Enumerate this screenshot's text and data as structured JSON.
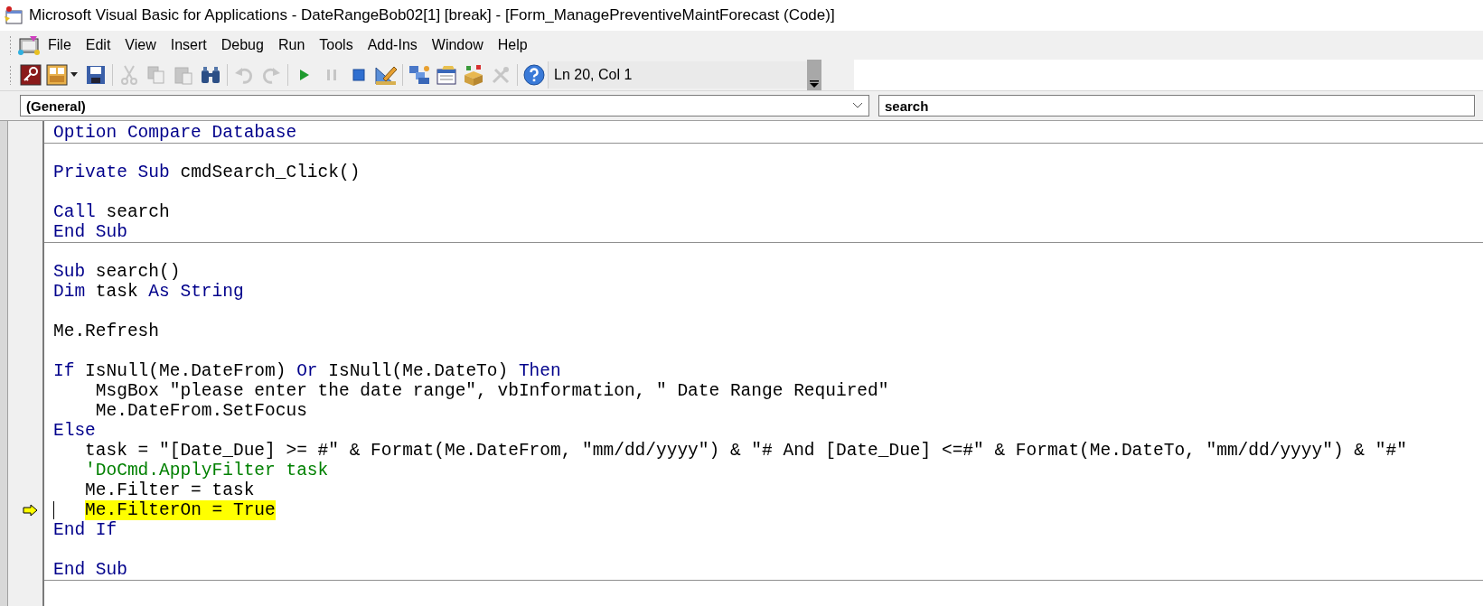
{
  "window": {
    "title": "Microsoft Visual Basic for Applications - DateRangeBob02[1] [break] - [Form_ManagePreventiveMaintForecast (Code)]"
  },
  "menu": [
    "File",
    "Edit",
    "View",
    "Insert",
    "Debug",
    "Run",
    "Tools",
    "Add-Ins",
    "Window",
    "Help"
  ],
  "toolbar": {
    "buttons": [
      {
        "kind": "view-host",
        "disabled": false
      },
      {
        "kind": "insert-form",
        "disabled": false
      },
      {
        "kind": "save",
        "disabled": false
      },
      {
        "kind": "separator"
      },
      {
        "kind": "cut",
        "disabled": true
      },
      {
        "kind": "copy",
        "disabled": true
      },
      {
        "kind": "paste",
        "disabled": true
      },
      {
        "kind": "find",
        "disabled": false
      },
      {
        "kind": "separator"
      },
      {
        "kind": "undo",
        "disabled": true
      },
      {
        "kind": "redo",
        "disabled": true
      },
      {
        "kind": "separator"
      },
      {
        "kind": "run",
        "disabled": false
      },
      {
        "kind": "pause",
        "disabled": true
      },
      {
        "kind": "stop",
        "disabled": false
      },
      {
        "kind": "design",
        "disabled": false
      },
      {
        "kind": "separator"
      },
      {
        "kind": "project",
        "disabled": false
      },
      {
        "kind": "properties",
        "disabled": false
      },
      {
        "kind": "browser",
        "disabled": false
      },
      {
        "kind": "toolbox",
        "disabled": true
      },
      {
        "kind": "separator"
      },
      {
        "kind": "help",
        "disabled": false
      }
    ],
    "position": "Ln 20, Col 1"
  },
  "object_box": {
    "value": "(General)"
  },
  "procedure_box": {
    "value": "search"
  },
  "code_sections": [
    {
      "lines": [
        {
          "kind": "code",
          "current": false,
          "tokens": [
            {
              "kind": "keyword",
              "text": "Option Compare Database"
            }
          ]
        }
      ]
    },
    {
      "lines": [
        {
          "kind": "blank"
        },
        {
          "kind": "code",
          "current": false,
          "tokens": [
            {
              "kind": "keyword",
              "text": "Private Sub"
            },
            {
              "kind": "plain",
              "text": " cmdSearch_Click()"
            }
          ]
        },
        {
          "kind": "blank"
        },
        {
          "kind": "code",
          "current": false,
          "tokens": [
            {
              "kind": "keyword",
              "text": "Call"
            },
            {
              "kind": "plain",
              "text": " search"
            }
          ]
        },
        {
          "kind": "code",
          "current": false,
          "tokens": [
            {
              "kind": "keyword",
              "text": "End Sub"
            }
          ]
        }
      ]
    },
    {
      "lines": [
        {
          "kind": "blank"
        },
        {
          "kind": "code",
          "current": false,
          "tokens": [
            {
              "kind": "keyword",
              "text": "Sub"
            },
            {
              "kind": "plain",
              "text": " search()"
            }
          ]
        },
        {
          "kind": "code",
          "current": false,
          "tokens": [
            {
              "kind": "keyword",
              "text": "Dim"
            },
            {
              "kind": "plain",
              "text": " task "
            },
            {
              "kind": "keyword",
              "text": "As String"
            }
          ]
        },
        {
          "kind": "blank"
        },
        {
          "kind": "code",
          "current": false,
          "tokens": [
            {
              "kind": "plain",
              "text": "Me.Refresh"
            }
          ]
        },
        {
          "kind": "blank"
        },
        {
          "kind": "code",
          "current": false,
          "tokens": [
            {
              "kind": "keyword",
              "text": "If"
            },
            {
              "kind": "plain",
              "text": " IsNull(Me.DateFrom) "
            },
            {
              "kind": "keyword",
              "text": "Or"
            },
            {
              "kind": "plain",
              "text": " IsNull(Me.DateTo) "
            },
            {
              "kind": "keyword",
              "text": "Then"
            }
          ]
        },
        {
          "kind": "code",
          "current": false,
          "tokens": [
            {
              "kind": "plain",
              "text": "    MsgBox \"please enter the date range\", vbInformation, \" Date Range Required\""
            }
          ]
        },
        {
          "kind": "code",
          "current": false,
          "tokens": [
            {
              "kind": "plain",
              "text": "    Me.DateFrom.SetFocus"
            }
          ]
        },
        {
          "kind": "code",
          "current": false,
          "tokens": [
            {
              "kind": "keyword",
              "text": "Else"
            }
          ]
        },
        {
          "kind": "code",
          "current": false,
          "tokens": [
            {
              "kind": "plain",
              "text": "   task = \"[Date_Due] >= #\" & Format(Me.DateFrom, \"mm/dd/yyyy\") & \"# And [Date_Due] <=#\" & Format(Me.DateTo, \"mm/dd/yyyy\") & \"#\""
            }
          ]
        },
        {
          "kind": "code",
          "current": false,
          "tokens": [
            {
              "kind": "comment",
              "text": "   'DoCmd.ApplyFilter task"
            }
          ]
        },
        {
          "kind": "code",
          "current": false,
          "tokens": [
            {
              "kind": "plain",
              "text": "   Me.Filter = task"
            }
          ]
        },
        {
          "kind": "code",
          "current": true,
          "tokens": [
            {
              "kind": "plain",
              "text": "   Me.FilterOn = True"
            }
          ]
        },
        {
          "kind": "code",
          "current": false,
          "tokens": [
            {
              "kind": "keyword",
              "text": "End If"
            }
          ]
        },
        {
          "kind": "blank"
        },
        {
          "kind": "code",
          "current": false,
          "tokens": [
            {
              "kind": "keyword",
              "text": "End Sub"
            }
          ]
        }
      ]
    }
  ]
}
